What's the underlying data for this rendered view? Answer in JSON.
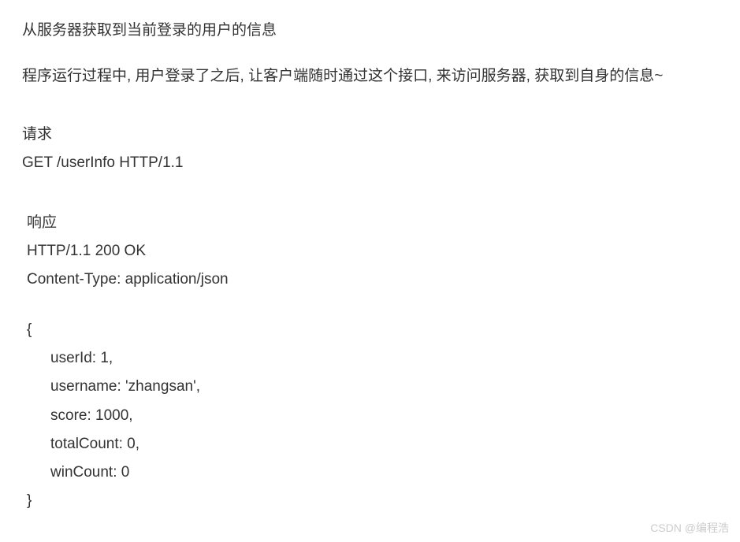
{
  "title": "从服务器获取到当前登录的用户的信息",
  "description": "程序运行过程中, 用户登录了之后, 让客户端随时通过这个接口, 来访问服务器, 获取到自身的信息~",
  "request": {
    "label": "请求",
    "line": "GET /userInfo HTTP/1.1"
  },
  "response": {
    "label": "响应",
    "statusLine": "HTTP/1.1 200 OK",
    "contentType": "Content-Type: application/json",
    "body": {
      "open": "{",
      "fields": [
        "userId: 1,",
        "username: 'zhangsan',",
        "score: 1000,",
        "totalCount: 0,",
        "winCount: 0"
      ],
      "close": "}"
    }
  },
  "watermark": "CSDN @编程浩"
}
